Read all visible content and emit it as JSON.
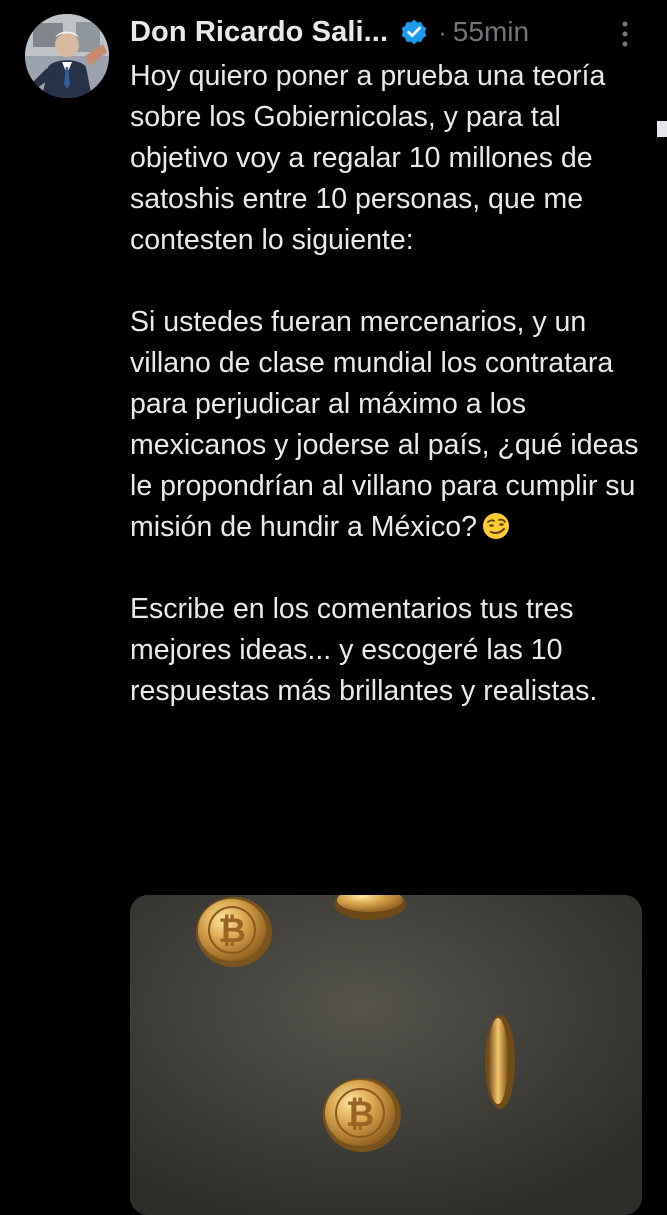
{
  "post": {
    "author_name": "Don Ricardo Sali...",
    "verified_icon": "verified-badge-icon",
    "separator": "·",
    "timestamp": "55min",
    "more_icon": "more-vertical-icon",
    "paragraphs": [
      "Hoy quiero poner a prueba una teoría sobre los Gobiernicolas, y para tal objetivo voy a regalar 10 millones de satoshis entre 10 personas, que me contesten lo siguiente:",
      "Si ustedes fueran mercenarios, y un villano de clase mundial los contratara para perjudicar al máximo a los mexicanos y joderse al país, ¿qué ideas le propondrían al villano para cumplir su misión de hundir a México?",
      "Escribe en los comentarios tus tres mejores ideas... y escogeré las 10 respuestas más brillantes y realistas."
    ],
    "emoji": "smirking-face-emoji",
    "media_image": "falling-bitcoin-coins-image"
  },
  "colors": {
    "background": "#000000",
    "text": "#e7e9ea",
    "secondary_text": "#71767b",
    "verified_blue": "#1d9bf0",
    "media_background": "#3c3b36",
    "coin_gold": "#d4a24c"
  }
}
